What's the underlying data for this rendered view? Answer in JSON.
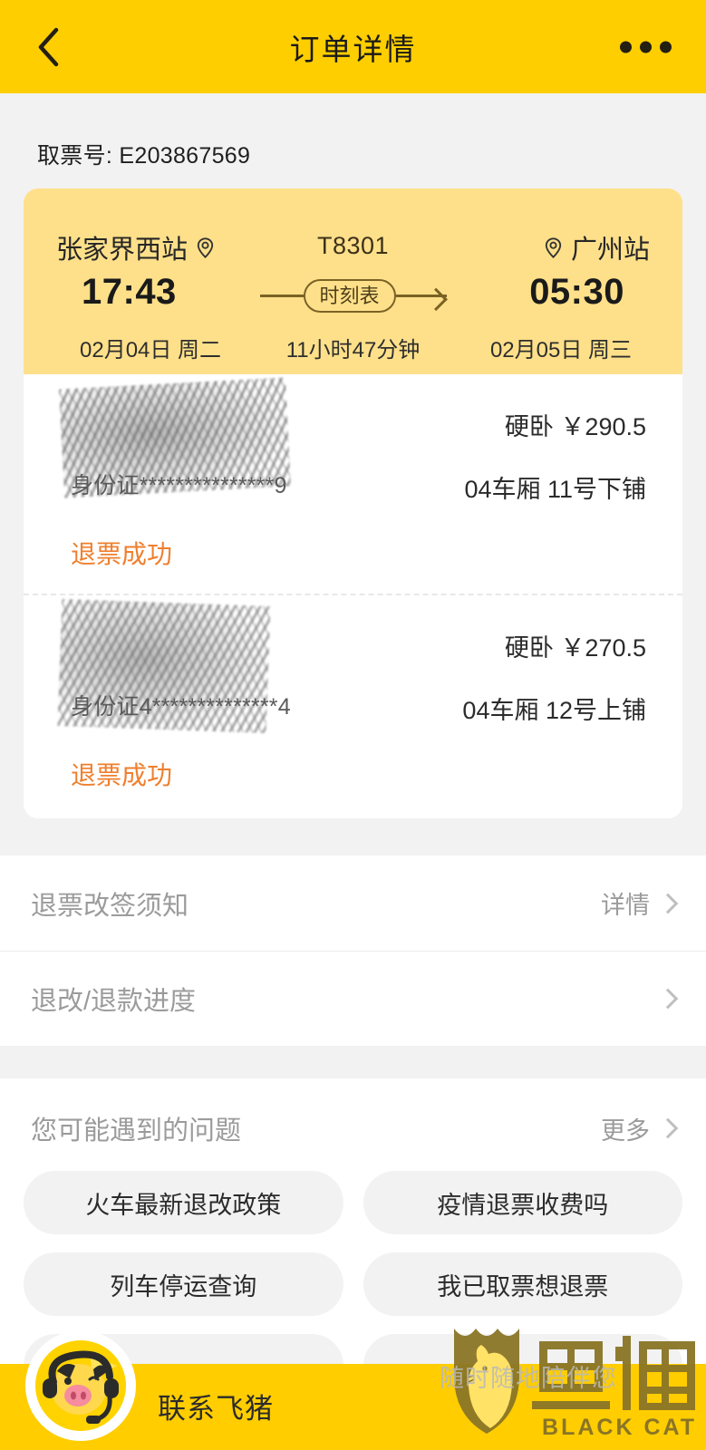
{
  "header": {
    "title": "订单详情",
    "back_icon": "chevron-left-icon",
    "more_icon": "more-dots-icon"
  },
  "pickup": {
    "text": "取票号: E203867569"
  },
  "trip": {
    "from_station": "张家界西站",
    "to_station": "广州站",
    "train_number": "T8301",
    "depart_time": "17:43",
    "arrive_time": "05:30",
    "depart_date": "02月04日 周二",
    "arrive_date": "02月05日 周三",
    "duration": "11小时47分钟",
    "schedule_chip": "时刻表",
    "from_pin_icon": "location-pin-icon",
    "to_pin_icon": "location-pin-icon"
  },
  "passengers": [
    {
      "name": "",
      "id_number": "身份证***************9",
      "status": "退票成功",
      "seat_type": "硬卧  ￥290.5",
      "seat_position": "04车厢 11号下铺"
    },
    {
      "name": "",
      "id_number": "身份证4**************4",
      "status": "退票成功",
      "seat_type": "硬卧  ￥270.5",
      "seat_position": "04车厢 12号上铺"
    }
  ],
  "rows": [
    {
      "label": "退票改签须知",
      "value": "详情",
      "chevron_icon": "chevron-right-icon"
    },
    {
      "label": "退改/退款进度",
      "value": "",
      "chevron_icon": "chevron-right-icon"
    }
  ],
  "faq": {
    "title": "您可能遇到的问题",
    "more_label": "更多",
    "more_chevron_icon": "chevron-right-icon",
    "chips": [
      "火车最新退改政策",
      "疫情退票收费吗",
      "列车停运查询",
      "我已取票想退票",
      "",
      ""
    ]
  },
  "bottom": {
    "contact_label": "联系飞猪",
    "pig_icon": "fliggy-pig-headset-icon"
  },
  "watermark": {
    "slogan": "随时随地陪伴您",
    "brand_cn": "黑猫",
    "brand_en": "BLACK CAT",
    "shield_icon": "black-cat-shield-icon"
  },
  "colors": {
    "header_yellow": "#ffce00",
    "card_yellow": "#ffe08a",
    "page_bg": "#f2f2f2",
    "status_orange": "#ef7f2e",
    "muted_gray": "#9b9b9b"
  }
}
